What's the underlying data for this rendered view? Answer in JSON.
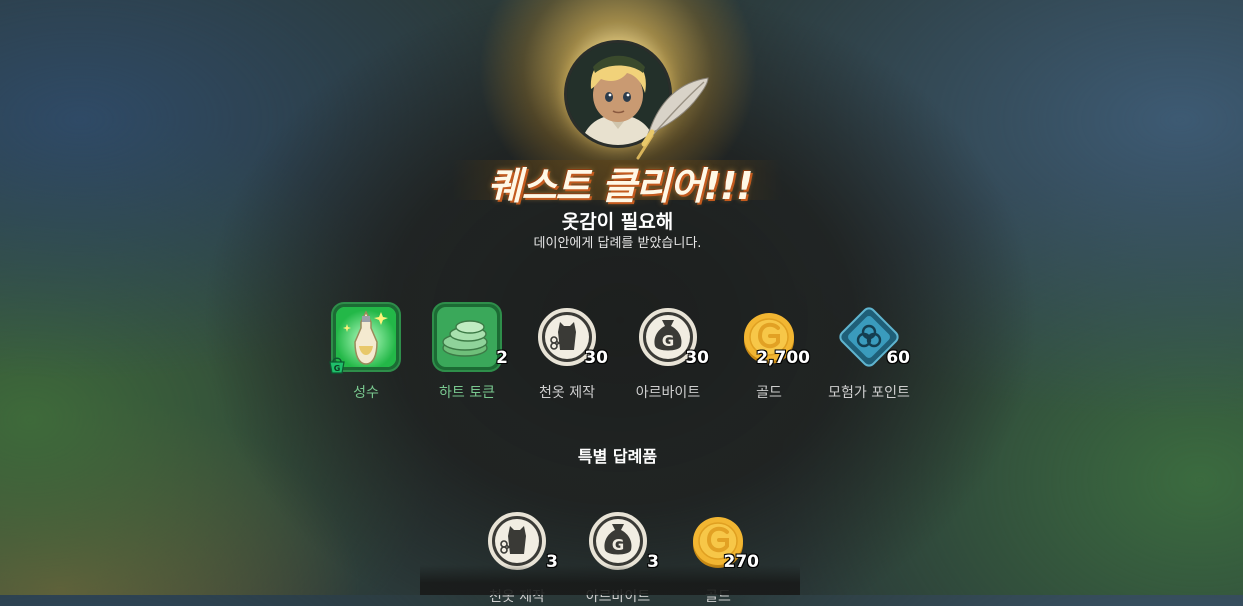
{
  "header": {
    "clear_title": "퀘스트 클리어!!!",
    "quest_name": "옷감이 필요해",
    "quest_desc": "데이안에게 답례를 받았습니다."
  },
  "rewards": [
    {
      "label": "성수",
      "count": "",
      "icon": "holy-water-icon"
    },
    {
      "label": "하트 토큰",
      "count": "2",
      "icon": "heart-token-icon"
    },
    {
      "label": "천옷 제작",
      "count": "30",
      "icon": "cloth-craft-icon"
    },
    {
      "label": "아르바이트",
      "count": "30",
      "icon": "part-time-job-icon"
    },
    {
      "label": "골드",
      "count": "2,700",
      "icon": "gold-coin-icon"
    },
    {
      "label": "모험가 포인트",
      "count": "60",
      "icon": "adventurer-point-icon"
    }
  ],
  "special": {
    "title": "특별 답례품",
    "items": [
      {
        "label": "천옷 제작",
        "count": "3",
        "icon": "cloth-craft-icon"
      },
      {
        "label": "아르바이트",
        "count": "3",
        "icon": "part-time-job-icon"
      },
      {
        "label": "골드",
        "count": "270",
        "icon": "gold-coin-icon"
      }
    ]
  },
  "colors": {
    "accent_green": "#79c88f",
    "title_orange": "#c35a1e",
    "gold": "#f2b632"
  }
}
